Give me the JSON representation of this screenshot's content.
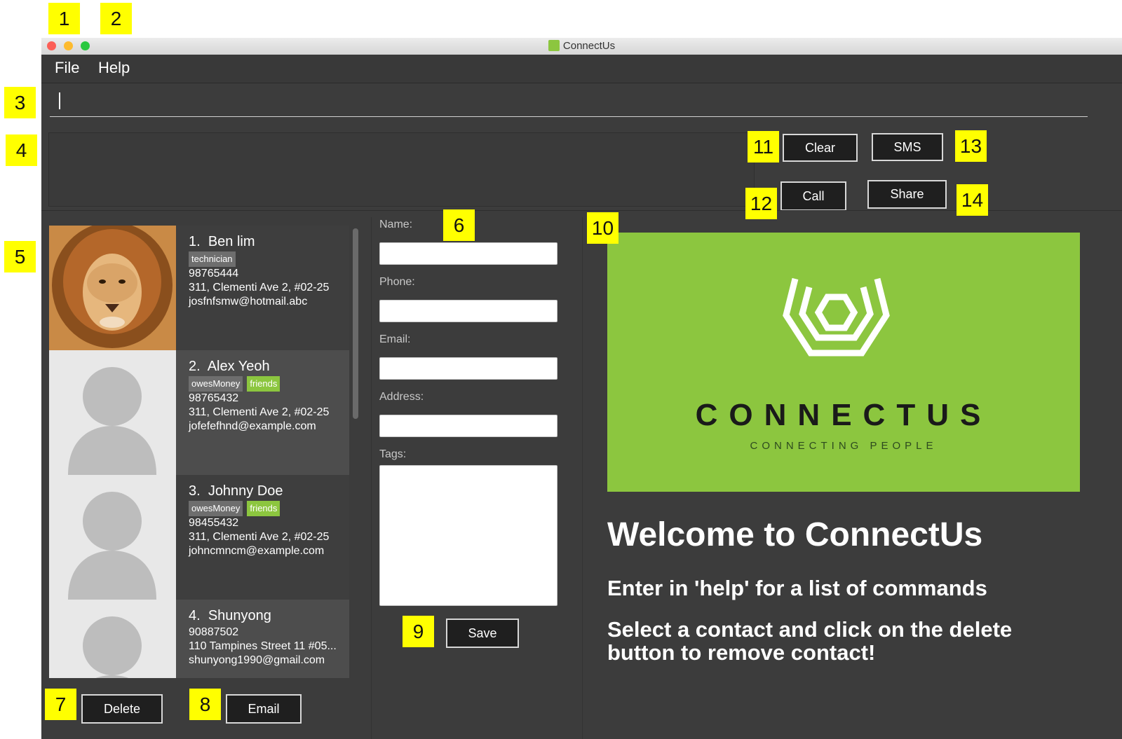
{
  "window": {
    "title": "ConnectUs"
  },
  "menu": {
    "file": "File",
    "help": "Help"
  },
  "command": {
    "value": ""
  },
  "buttons": {
    "clear": "Clear",
    "sms": "SMS",
    "call": "Call",
    "share": "Share",
    "delete": "Delete",
    "email": "Email",
    "save": "Save"
  },
  "contacts": [
    {
      "index": "1.",
      "name": "Ben lim",
      "tags": [
        "technician"
      ],
      "phone": "98765444",
      "address": "311, Clementi Ave 2, #02-25",
      "email": "josfnfsmw@hotmail.abc",
      "photo": "lion-photo"
    },
    {
      "index": "2.",
      "name": "Alex Yeoh",
      "tags": [
        "owesMoney",
        "friends"
      ],
      "phone": "98765432",
      "address": "311, Clementi Ave 2, #02-25",
      "email": "jofefefhnd@example.com",
      "photo": "default-avatar"
    },
    {
      "index": "3.",
      "name": "Johnny Doe",
      "tags": [
        "owesMoney",
        "friends"
      ],
      "phone": "98455432",
      "address": "311, Clementi Ave 2, #02-25",
      "email": "johncmncm@example.com",
      "photo": "default-avatar"
    },
    {
      "index": "4.",
      "name": "Shunyong",
      "tags": [],
      "phone": "90887502",
      "address": "110 Tampines Street 11 #05...",
      "email": "shunyong1990@gmail.com",
      "photo": "default-avatar"
    }
  ],
  "form": {
    "name_label": "Name:",
    "phone_label": "Phone:",
    "email_label": "Email:",
    "address_label": "Address:",
    "tags_label": "Tags:",
    "name_value": "",
    "phone_value": "",
    "email_value": "",
    "address_value": "",
    "tags_value": ""
  },
  "banner": {
    "brand": "CONNECTUS",
    "tagline": "CONNECTING PEOPLE"
  },
  "welcome": {
    "heading": "Welcome to ConnectUs",
    "line1": "Enter in 'help' for a list of commands",
    "line2": "Select a contact and click on the delete button to remove contact!"
  },
  "callouts": [
    "1",
    "2",
    "3",
    "4",
    "5",
    "6",
    "7",
    "8",
    "9",
    "10",
    "11",
    "12",
    "13",
    "14"
  ],
  "colors": {
    "window_bg": "#3c3c3c",
    "banner_green": "#8cc63f",
    "tag_gray": "#6e6e6e",
    "tag_green": "#8cc63f",
    "callout_yellow": "#ffff00"
  }
}
